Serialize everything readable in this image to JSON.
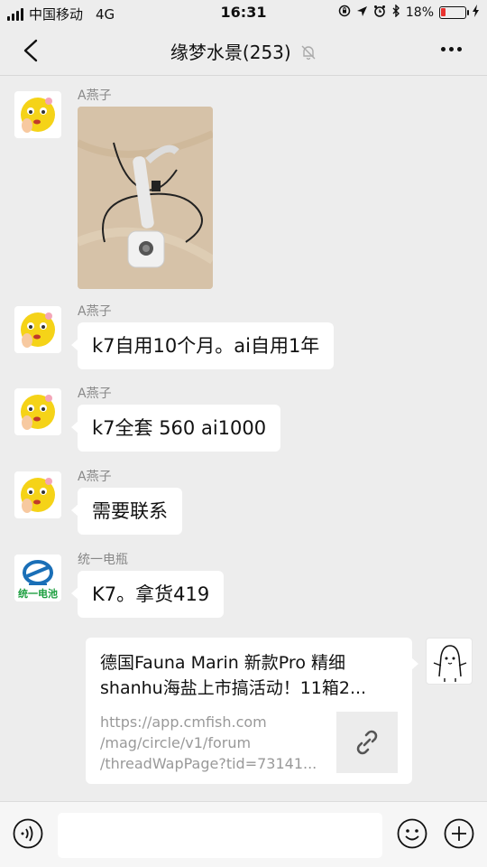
{
  "status_bar": {
    "carrier": "中国移动",
    "network": "4G",
    "time": "16:31",
    "battery_percent": "18%",
    "battery_level": 0.18,
    "battery_color": "#e8322f"
  },
  "header": {
    "title": "缘梦水景(253)",
    "back_icon": "chevron-left-icon",
    "mute_icon": "bell-off-icon",
    "more_icon": "more-dots-icon"
  },
  "messages": [
    {
      "sender": "A燕子",
      "type": "image",
      "avatar": "emoji-avatar"
    },
    {
      "sender": "A燕子",
      "type": "text",
      "text": "k7自用10个月。ai自用1年"
    },
    {
      "sender": "A燕子",
      "type": "text",
      "text": "k7全套 560 ai1000"
    },
    {
      "sender": "A燕子",
      "type": "text",
      "text": "需要联系"
    },
    {
      "sender": "统一电瓶",
      "type": "text",
      "text": "K7。拿货419",
      "avatar_text": "统一电池"
    },
    {
      "type": "link",
      "title_line1": "德国Fauna Marin 新款Pro 精细",
      "title_line2": "shanhu海盐上市搞活动！11箱2...",
      "url_line1": "https://app.cmfish.com",
      "url_line2": "/mag/circle/v1/forum",
      "url_line3": "/threadWapPage?tid=73141..."
    }
  ],
  "input_bar": {
    "voice_icon": "voice-icon",
    "emoji_icon": "emoji-icon",
    "plus_icon": "plus-icon"
  }
}
